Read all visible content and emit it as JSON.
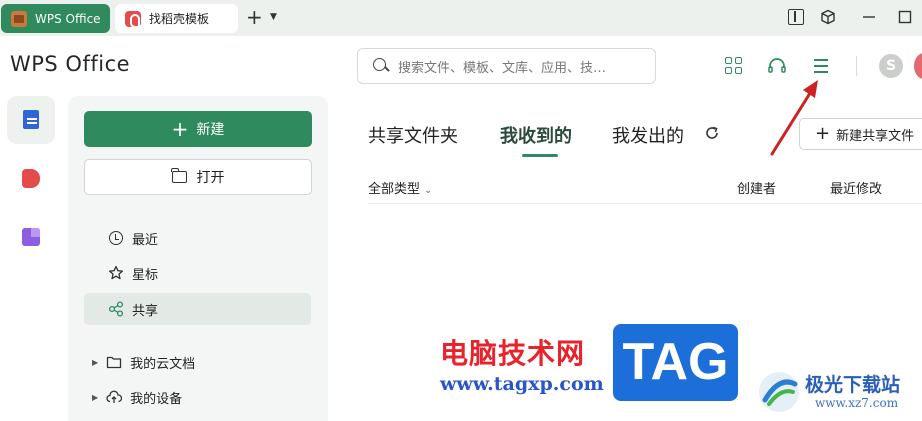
{
  "tabs": [
    {
      "label": "WPS Office",
      "icon": "wps-home-icon",
      "active": true
    },
    {
      "label": "找稻壳模板",
      "icon": "docer-icon",
      "active": false
    }
  ],
  "header": {
    "logo": "WPS Office",
    "search_placeholder": "搜索文件、模板、文库、应用、技…"
  },
  "sidebar": {
    "new_label": "新建",
    "open_label": "打开",
    "nav": [
      {
        "label": "最近",
        "icon": "clock-icon"
      },
      {
        "label": "星标",
        "icon": "star-icon"
      },
      {
        "label": "共享",
        "icon": "share-icon",
        "selected": true
      }
    ],
    "tree": [
      {
        "label": "我的云文档",
        "icon": "folder-icon"
      },
      {
        "label": "我的设备",
        "icon": "cloud-upload-icon"
      }
    ]
  },
  "main": {
    "tabs": [
      {
        "label": "共享文件夹"
      },
      {
        "label": "我收到的",
        "active": true
      },
      {
        "label": "我发出的"
      }
    ],
    "new_share_label": "新建共享文件",
    "filter_label": "全部类型",
    "columns": [
      "创建者",
      "最近修改"
    ]
  },
  "watermark": {
    "cn": "电脑技术网",
    "url": "www.tagxp.com",
    "tag": "TAG",
    "site_cn": "极光下载站",
    "site_url": "www.xz7.com"
  },
  "colors": {
    "accent": "#2f8a5d",
    "annotation": "#cc2222"
  }
}
